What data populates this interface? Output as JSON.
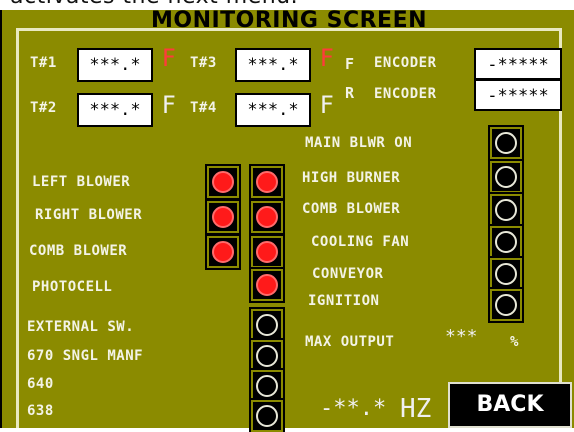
{
  "top_text": "activates the next menu.",
  "title": "MONITORING SCREEN",
  "temps": [
    {
      "label": "T#1",
      "value": "***.*",
      "unit": "F"
    },
    {
      "label": "T#3",
      "value": "***.*",
      "unit": "F"
    },
    {
      "label": "T#2",
      "value": "***.*",
      "unit": "F"
    },
    {
      "label": "T#4",
      "value": "***.*",
      "unit": "F"
    }
  ],
  "encoders": [
    {
      "sup": "F",
      "label": "ENCODER",
      "value": "-*****"
    },
    {
      "sup": "R",
      "label": "ENCODER",
      "value": "-*****"
    }
  ],
  "left_items": [
    "LEFT BLOWER",
    "RIGHT BLOWER",
    "COMB BLOWER",
    "PHOTOCELL",
    "EXTERNAL SW.",
    "670 SNGL MANF",
    "640",
    "638"
  ],
  "right_items": [
    "MAIN BLWR ON",
    "HIGH BURNER",
    "COMB BLOWER",
    "COOLING FAN",
    "CONVEYOR",
    "IGNITION"
  ],
  "max_output": {
    "label": "MAX OUTPUT",
    "value": "***",
    "unit": "%"
  },
  "frequency": {
    "value": "-**.*",
    "unit": "HZ"
  },
  "back_label": "BACK",
  "indicator_colors": {
    "on": "#ff1a1a",
    "off": "#000000"
  }
}
